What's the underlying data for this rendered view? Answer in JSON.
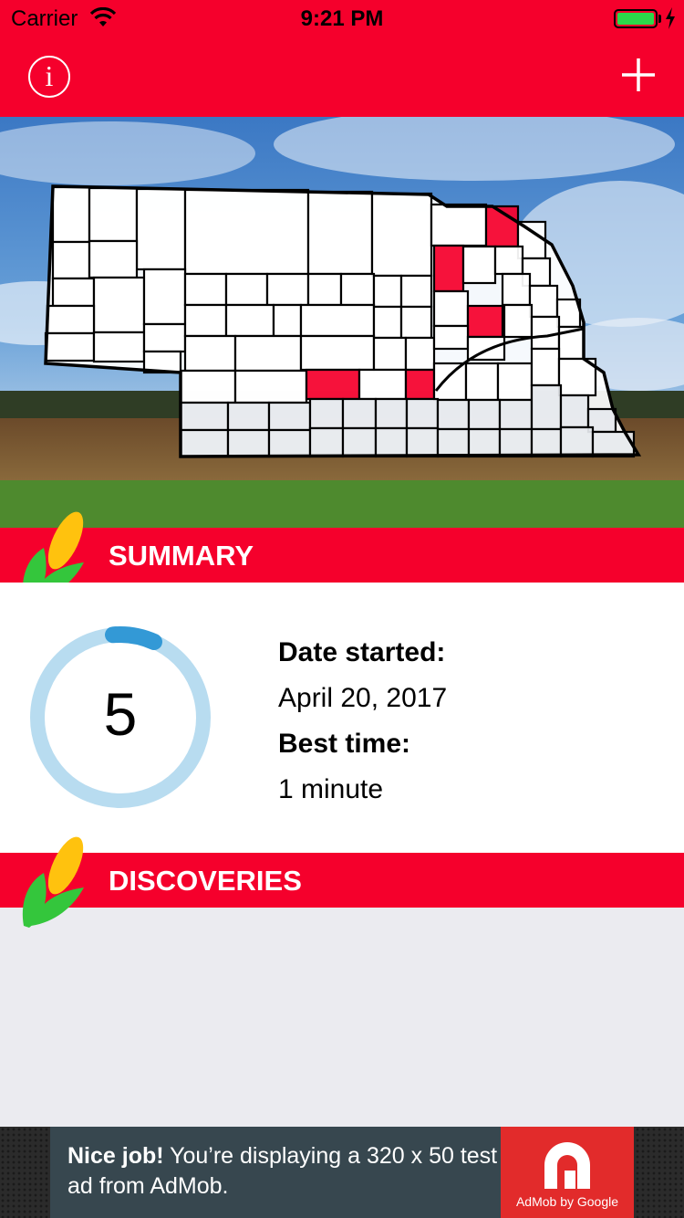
{
  "status_bar": {
    "carrier": "Carrier",
    "time": "9:21 PM",
    "battery_level": 1.0
  },
  "nav": {
    "info_label": "i"
  },
  "hero": {
    "highlighted_counties_count": 5
  },
  "summary": {
    "title": "SUMMARY",
    "count": "5",
    "date_started_label": "Date started:",
    "date_started_value": "April 20, 2017",
    "best_time_label": "Best time:",
    "best_time_value": "1 minute"
  },
  "discoveries": {
    "title": "DISCOVERIES"
  },
  "ad": {
    "headline": "Nice job!",
    "body": " You’re displaying a 320 x 50 test ad from AdMob.",
    "logo_caption": "AdMob by Google"
  },
  "colors": {
    "brand_red": "#f5002c",
    "ring_track": "#b8dcf0",
    "ring_progress": "#3399d6",
    "corn_yellow": "#ffc20e",
    "corn_green": "#34c63c"
  }
}
